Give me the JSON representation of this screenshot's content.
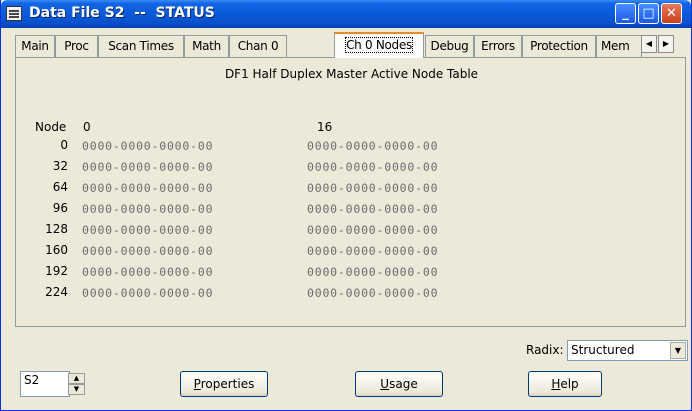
{
  "window": {
    "title": "Data File S2  --  STATUS",
    "minimize_glyph": "_",
    "maximize_glyph": "□",
    "close_glyph": "✕"
  },
  "tabs": [
    {
      "label": "Main"
    },
    {
      "label": "Proc"
    },
    {
      "label": "Scan Times"
    },
    {
      "label": "Math"
    },
    {
      "label": "Chan 0"
    },
    {
      "label": "Ch 0 Nodes",
      "active": true
    },
    {
      "label": "Debug"
    },
    {
      "label": "Errors"
    },
    {
      "label": "Protection"
    },
    {
      "label": "Mem"
    }
  ],
  "tab_scroll": {
    "left": "◀",
    "right": "▶"
  },
  "panel": {
    "title": "DF1 Half Duplex Master Active Node Table",
    "node_header": "Node",
    "col0_header": "0",
    "col1_header": "16",
    "rows": [
      {
        "node": "0",
        "a": "0000-0000-0000-00",
        "b": "0000-0000-0000-00"
      },
      {
        "node": "32",
        "a": "0000-0000-0000-00",
        "b": "0000-0000-0000-00"
      },
      {
        "node": "64",
        "a": "0000-0000-0000-00",
        "b": "0000-0000-0000-00"
      },
      {
        "node": "96",
        "a": "0000-0000-0000-00",
        "b": "0000-0000-0000-00"
      },
      {
        "node": "128",
        "a": "0000-0000-0000-00",
        "b": "0000-0000-0000-00"
      },
      {
        "node": "160",
        "a": "0000-0000-0000-00",
        "b": "0000-0000-0000-00"
      },
      {
        "node": "192",
        "a": "0000-0000-0000-00",
        "b": "0000-0000-0000-00"
      },
      {
        "node": "224",
        "a": "0000-0000-0000-00",
        "b": "0000-0000-0000-00"
      }
    ]
  },
  "radix": {
    "label": "Radix:",
    "value": "Structured",
    "arrow": "▼"
  },
  "footer": {
    "file_value": "S2",
    "spin_up": "▲",
    "spin_down": "▼",
    "properties_underline": "P",
    "properties_rest": "roperties",
    "usage_underline": "U",
    "usage_rest": "sage",
    "help_underline": "H",
    "help_rest": "elp"
  }
}
